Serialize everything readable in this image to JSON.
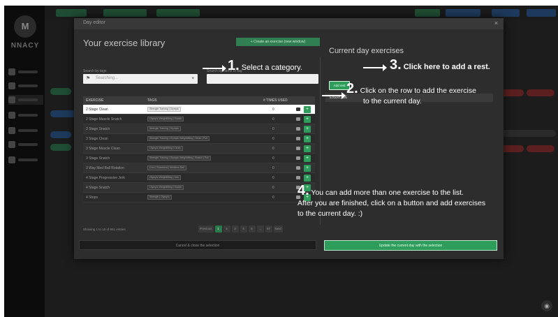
{
  "modal": {
    "title": "Day editor",
    "close_glyph": "×",
    "library_title": "Your exercise library",
    "create_button": "+ Create an exercise (new window)",
    "search_by_tags_label": "Search by tags",
    "search_by_name_label": "Search by name or tag",
    "search_placeholder": "Searching...",
    "table_headers": {
      "exercise": "EXERCISE",
      "tags": "TAGS",
      "times_used": "# TIMES USED"
    },
    "rows": [
      {
        "name": "2 Stage Clean",
        "tag": "Strength Training | Olympic",
        "count": "0"
      },
      {
        "name": "2 Stage Muscle Snatch",
        "tag": "Olympic Weightlifting | Snatch",
        "count": "0"
      },
      {
        "name": "2 Stage Snatch",
        "tag": "Strength Training | Olympic",
        "count": "0"
      },
      {
        "name": "3 Stage Clean",
        "tag": "Strength Training | Olympic Weightlifting | Clean | Pull",
        "count": "0"
      },
      {
        "name": "3 Stage Muscle Clean",
        "tag": "Olympic Weightlifting | Clean",
        "count": "0"
      },
      {
        "name": "3 Stage Snatch",
        "tag": "Strength Training | Olympic Weightlifting | Snatch | Pull",
        "count": "0"
      },
      {
        "name": "3 Way Med Ball Rotation",
        "tag": "Core | Rotational | Medicine Ball",
        "count": "0"
      },
      {
        "name": "4 Stage Progressive Jerk",
        "tag": "Olympic Weightlifting | Jerk",
        "count": "0"
      },
      {
        "name": "4 Stage Snatch",
        "tag": "Olympic Weightlifting | Snatch",
        "count": "0"
      },
      {
        "name": "4 Stops",
        "tag": "Strength | Olympic",
        "count": "0"
      }
    ],
    "showing_text": "Showing 1 to 10 of 851 entries",
    "pagination": [
      "Previous",
      "1",
      "2",
      "3",
      "4",
      "5",
      "...",
      "87",
      "Next"
    ],
    "cancel_button": "Cancel & close the selection",
    "current_day_title": "Current day exercises",
    "add_rest_button": "Add rest",
    "current_day_header": "EXERCISE",
    "update_button": "Update the current day with the selection"
  },
  "annotations": {
    "step1_num": "1.",
    "step1_text": "Select a category.",
    "step2_num": "2.",
    "step2_text_line1": "Click on the row to add the exercise",
    "step2_text_line2": "to the current day.",
    "step3_num": "3.",
    "step3_text": "Click here to add a rest.",
    "step4_num": "4.",
    "step4_line1": "You can add more than one exercise to the list.",
    "step4_line2": "After you are finished, click on a button and add exercises",
    "step4_line3": "to the current day. :)"
  },
  "background": {
    "logo_text": "NNACY",
    "chat_icon_glyph": "◉"
  },
  "colors": {
    "accent_green": "#2e9c5a",
    "modal_bg": "#2d2d2d",
    "annotation_text": "#ffffff"
  }
}
